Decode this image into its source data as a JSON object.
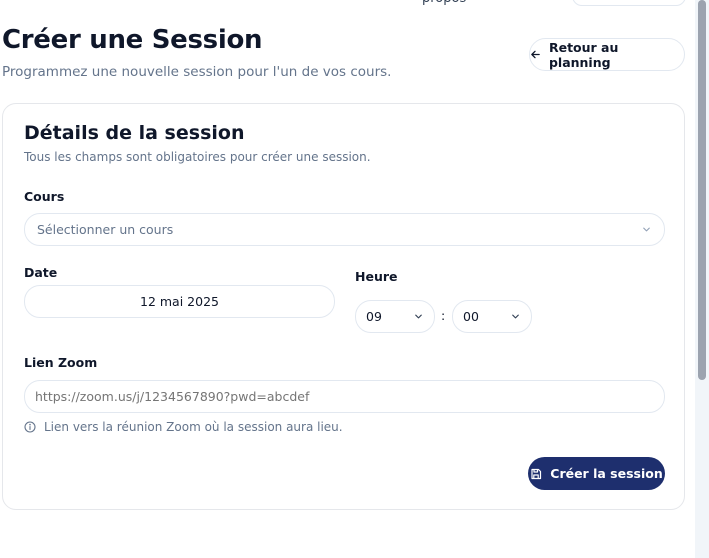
{
  "header_remnant": {
    "text": "propos"
  },
  "page": {
    "title": "Créer une Session",
    "subtitle": "Programmez une nouvelle session pour l'un de vos cours.",
    "back_label": "Retour au planning"
  },
  "card": {
    "title": "Détails de la session",
    "description": "Tous les champs sont obligatoires pour créer une session."
  },
  "form": {
    "course_label": "Cours",
    "course_placeholder": "Sélectionner un cours",
    "date_label": "Date",
    "date_value": "12 mai 2025",
    "time_label": "Heure",
    "hour_value": "09",
    "minute_value": "00",
    "time_separator": ":",
    "zoom_label": "Lien Zoom",
    "zoom_placeholder": "https://zoom.us/j/1234567890?pwd=abcdef",
    "zoom_hint": "Lien vers la réunion Zoom où la session aura lieu.",
    "submit_label": "Créer la session"
  },
  "icons": {
    "back": "arrow-left-icon",
    "chevron": "chevron-down-icon",
    "info": "info-icon",
    "save": "save-icon"
  },
  "colors": {
    "primary": "#1e2f6e",
    "text": "#0f172a",
    "muted": "#64748b",
    "border": "#e2e8f0"
  }
}
